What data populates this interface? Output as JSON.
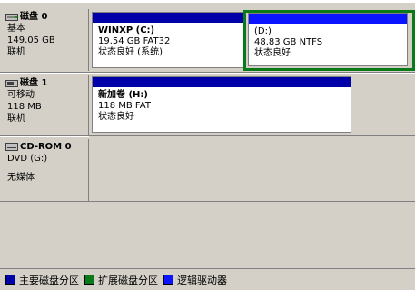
{
  "colors": {
    "primary": "#0000a8",
    "extended": "#0a7a18",
    "logical": "#0b14ff"
  },
  "disks": [
    {
      "icon": "hard-disk-icon",
      "name": "磁盘 0",
      "type": "基本",
      "size": "149.05 GB",
      "status": "联机",
      "partitions": [
        {
          "name": "WINXP  (C:)",
          "detail": "19.54 GB FAT32",
          "status": "状态良好 (系统)"
        },
        {
          "name": " (D:)",
          "detail": "48.83 GB NTFS",
          "status": "状态良好"
        }
      ]
    },
    {
      "icon": "removable-disk-icon",
      "name": "磁盘 1",
      "type": "可移动",
      "size": "118 MB",
      "status": "联机",
      "partitions": [
        {
          "name": "新加卷  (H:)",
          "detail": "118 MB FAT",
          "status": "状态良好"
        }
      ]
    },
    {
      "icon": "cdrom-icon",
      "name": "CD-ROM 0",
      "type": "DVD (G:)",
      "status": "无媒体"
    }
  ],
  "legend": [
    {
      "label": "主要磁盘分区",
      "color": "#0000a8"
    },
    {
      "label": "扩展磁盘分区",
      "color": "#0a7a18"
    },
    {
      "label": "逻辑驱动器",
      "color": "#0b14ff"
    }
  ]
}
